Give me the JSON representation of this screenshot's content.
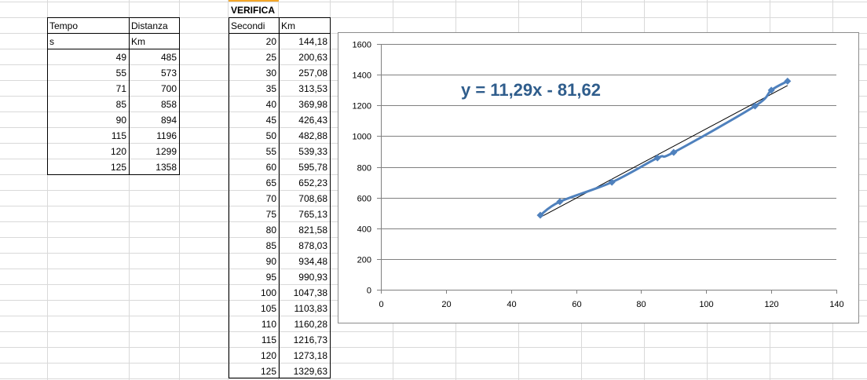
{
  "table1": {
    "headers": [
      "Tempo",
      "Distanza"
    ],
    "units": [
      "s",
      "Km"
    ],
    "rows": [
      [
        "49",
        "485"
      ],
      [
        "55",
        "573"
      ],
      [
        "71",
        "700"
      ],
      [
        "85",
        "858"
      ],
      [
        "90",
        "894"
      ],
      [
        "115",
        "1196"
      ],
      [
        "120",
        "1299"
      ],
      [
        "125",
        "1358"
      ]
    ]
  },
  "table2": {
    "title": "VERIFICA",
    "headers": [
      "Secondi",
      "Km"
    ],
    "rows": [
      [
        "20",
        "144,18"
      ],
      [
        "25",
        "200,63"
      ],
      [
        "30",
        "257,08"
      ],
      [
        "35",
        "313,53"
      ],
      [
        "40",
        "369,98"
      ],
      [
        "45",
        "426,43"
      ],
      [
        "50",
        "482,88"
      ],
      [
        "55",
        "539,33"
      ],
      [
        "60",
        "595,78"
      ],
      [
        "65",
        "652,23"
      ],
      [
        "70",
        "708,68"
      ],
      [
        "75",
        "765,13"
      ],
      [
        "80",
        "821,58"
      ],
      [
        "85",
        "878,03"
      ],
      [
        "90",
        "934,48"
      ],
      [
        "95",
        "990,93"
      ],
      [
        "100",
        "1047,38"
      ],
      [
        "105",
        "1103,83"
      ],
      [
        "110",
        "1160,28"
      ],
      [
        "115",
        "1216,73"
      ],
      [
        "120",
        "1273,18"
      ],
      [
        "125",
        "1329,63"
      ]
    ]
  },
  "chart_data": {
    "type": "scatter",
    "equation": "y = 11,29x - 81,62",
    "xlim": [
      0,
      140
    ],
    "ylim": [
      0,
      1600
    ],
    "xticks": [
      0,
      20,
      40,
      60,
      80,
      100,
      120,
      140
    ],
    "yticks": [
      0,
      200,
      400,
      600,
      800,
      1000,
      1200,
      1400,
      1600
    ],
    "grid": true,
    "series": [
      {
        "x": [
          49,
          55,
          71,
          85,
          90,
          115,
          120,
          125
        ],
        "y": [
          485,
          573,
          700,
          858,
          894,
          1196,
          1299,
          1358
        ],
        "color": "#4f81bd",
        "marker": "diamond",
        "smooth": true
      }
    ],
    "trendline": {
      "slope": 11.29,
      "intercept": -81.62,
      "x": [
        49,
        125
      ],
      "color": "#000000"
    }
  },
  "colors": {
    "gridline": "#d9d9d9",
    "series": "#4f81bd",
    "equation": "#2f5d8c"
  }
}
